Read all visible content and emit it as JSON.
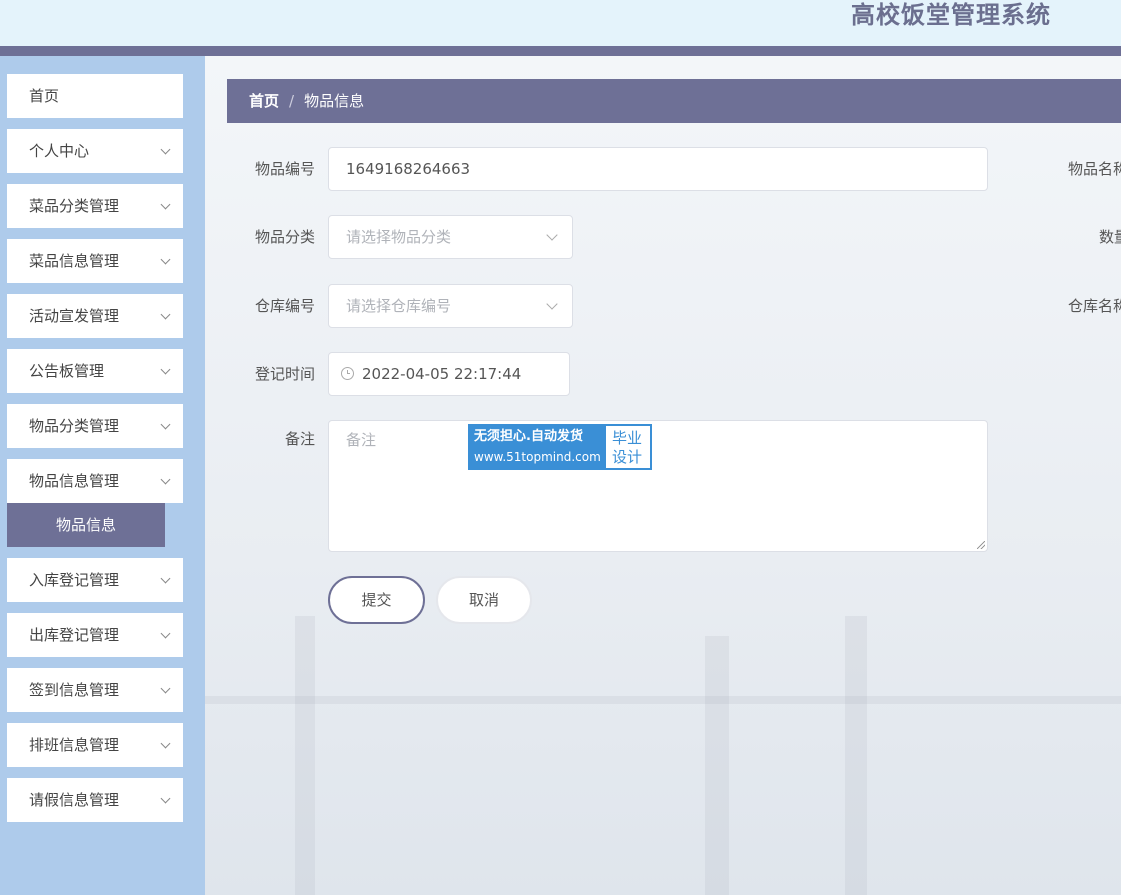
{
  "header": {
    "title": "高校饭堂管理系统"
  },
  "sidebar": {
    "items": [
      {
        "label": "首页"
      },
      {
        "label": "个人中心"
      },
      {
        "label": "菜品分类管理"
      },
      {
        "label": "菜品信息管理"
      },
      {
        "label": "活动宣发管理"
      },
      {
        "label": "公告板管理"
      },
      {
        "label": "物品分类管理"
      },
      {
        "label": "物品信息管理"
      },
      {
        "label": "入库登记管理"
      },
      {
        "label": "出库登记管理"
      },
      {
        "label": "签到信息管理"
      },
      {
        "label": "排班信息管理"
      },
      {
        "label": "请假信息管理"
      }
    ],
    "active_sub": "物品信息"
  },
  "breadcrumb": {
    "home": "首页",
    "separator": "/",
    "current": "物品信息"
  },
  "form": {
    "item_code": {
      "label": "物品编号",
      "value": "1649168264663"
    },
    "item_name": {
      "label": "物品名称"
    },
    "item_category": {
      "label": "物品分类",
      "placeholder": "请选择物品分类"
    },
    "quantity": {
      "label": "数量"
    },
    "warehouse_code": {
      "label": "仓库编号",
      "placeholder": "请选择仓库编号"
    },
    "warehouse_name": {
      "label": "仓库名称"
    },
    "register_time": {
      "label": "登记时间",
      "value": "2022-04-05 22:17:44"
    },
    "remark": {
      "label": "备注",
      "placeholder": "备注"
    },
    "submit": "提交",
    "cancel": "取消"
  },
  "watermark": {
    "line1": "无须担心.自动发货",
    "line2": "www.51topmind.com",
    "right1": "毕业",
    "right2": "设计"
  }
}
